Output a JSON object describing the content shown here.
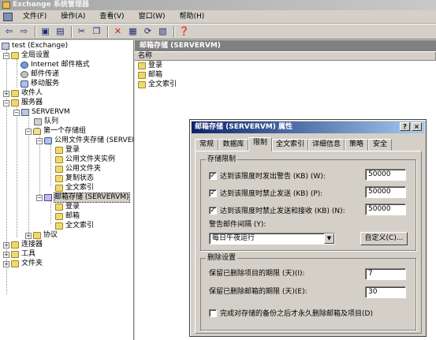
{
  "window": {
    "title": "Exchange 系统管理器"
  },
  "menu": [
    "文件(F)",
    "操作(A)",
    "查看(V)",
    "窗口(W)",
    "帮助(H)"
  ],
  "toolbar": {
    "icons": [
      "back-arrow-icon",
      "forward-arrow-icon",
      "up-folder-icon",
      "show-hide-tree-icon",
      "cut-icon",
      "copy-icon",
      "delete-icon",
      "properties-icon",
      "refresh-icon",
      "export-list-icon",
      "help-icon"
    ]
  },
  "tree": {
    "root": "test (Exchange)",
    "global_settings": "全局设置",
    "internet_format": "Internet 邮件格式",
    "message_delivery": "邮件传递",
    "mobile_services": "移动服务",
    "recipients": "收件人",
    "servers": "服务器",
    "server_name": "SERVERVM",
    "queues": "队列",
    "first_storage_group": "第一个存储组",
    "public_store": "公用文件夹存储 (SERVERV",
    "pf_logons": "登录",
    "pf_instances": "公用文件夹实例",
    "pf_folders": "公用文件夹",
    "pf_replication": "复制状态",
    "pf_fulltext": "全文索引",
    "mailbox_store": "邮箱存储 (SERVERVM)",
    "mb_logons": "登录",
    "mb_mailboxes": "邮箱",
    "mb_fulltext": "全文索引",
    "protocols": "协议",
    "connectors": "连接器",
    "tools": "工具",
    "folders": "文件夹"
  },
  "right_pane": {
    "header": "邮箱存储 (SERVERVM)",
    "column": "名称",
    "items": [
      "登录",
      "邮箱",
      "全文索引"
    ]
  },
  "dialog": {
    "title": "邮箱存储 (SERVERVM) 属性",
    "help_btn": "?",
    "close_btn": "×",
    "tabs": [
      "常规",
      "数据库",
      "限制",
      "全文索引",
      "详细信息",
      "策略",
      "安全"
    ],
    "active_tab": "限制",
    "storage_limits": {
      "title": "存储限制",
      "warn_label": "达到该限度时发出警告 (KB) (W):",
      "warn_value": "50000",
      "prohibit_send_label": "达到该限度时禁止发送 (KB) (P):",
      "prohibit_send_value": "50000",
      "prohibit_send_receive_label": "达到该限度时禁止发送和接收 (KB) (N):",
      "prohibit_send_receive_value": "50000",
      "interval_label": "警告邮件间隔 (Y):",
      "interval_value": "每日午夜运行",
      "customize_button": "自定义(C)..."
    },
    "deletion": {
      "title": "删除设置",
      "keep_items_label": "保留已删除项目的期限 (天)(I):",
      "keep_items_value": "7",
      "keep_mailboxes_label": "保留已删除邮箱的期限 (天)(E):",
      "keep_mailboxes_value": "30",
      "no_permanent_label": "完成对存储的备份之后才永久删除邮箱及项目(D)"
    }
  }
}
